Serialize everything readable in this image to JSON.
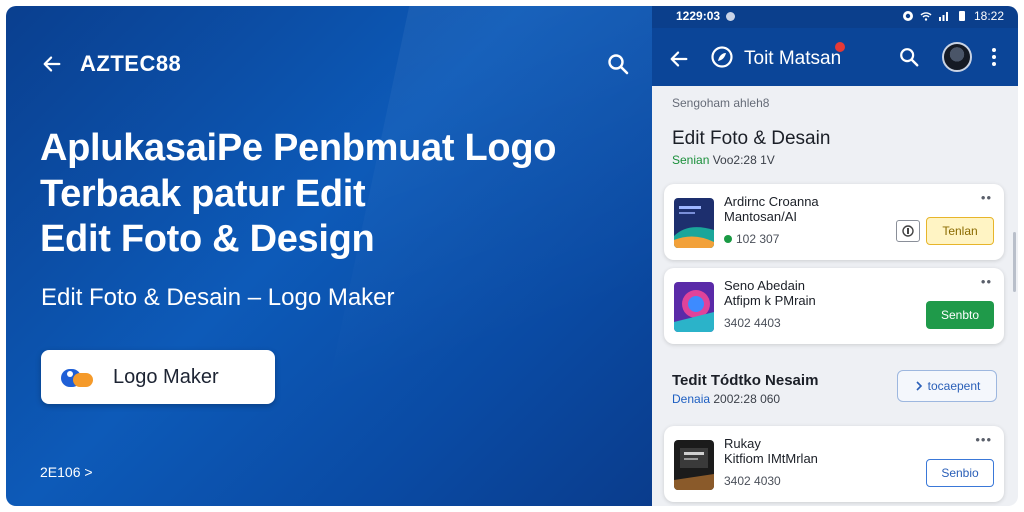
{
  "hero": {
    "brand": "AZTEC88",
    "title_lines": [
      "AplukasaiPe Penbmuat Logo",
      "Terbaak patur Edit",
      "Edit Foto & Design"
    ],
    "subtitle": "Edit Foto & Desain – Logo Maker",
    "cta_label": "Logo Maker",
    "footer": "2E106 >",
    "icons": {
      "back": "arrow-left-icon",
      "search": "search-icon",
      "cta": "logo-maker-app-icon"
    }
  },
  "phone": {
    "status": {
      "time_left": "1229:03",
      "time_right": "18:22",
      "icons": [
        "notification-dot-icon",
        "data-saver-icon",
        "wifi-icon",
        "signal-icon",
        "battery-icon"
      ]
    },
    "appbar": {
      "title": "Toit Matsan",
      "icons": [
        "arrow-left-icon",
        "app-logo-icon",
        "search-icon",
        "avatar",
        "more-vert-icon"
      ]
    },
    "breadcrumb": "Sengoham ahleh8",
    "section1": {
      "title": "Edit Foto & Desain",
      "meta_green": "Senian",
      "meta_rest": " Voo2:28 1V"
    },
    "apps": [
      {
        "name_line1": "Ardirnc Croanna",
        "name_line2": "Mantosan/AI",
        "meta": "102 307",
        "show_rating_dot": true,
        "action": "Tenlan",
        "action_style": "yellow",
        "has_secondary_icon": true,
        "more": "••"
      },
      {
        "name_line1": "Seno Abedain",
        "name_line2": "Atfipm k PMrain",
        "meta": "3402 4403",
        "show_rating_dot": false,
        "action": "Senbto",
        "action_style": "green",
        "has_secondary_icon": false,
        "more": "••"
      },
      {
        "name_line1": "Rukay",
        "name_line2": "Kitfiom IMtMrlan",
        "meta": "3402 4030",
        "show_rating_dot": false,
        "action": "Senbio",
        "action_style": "outline",
        "has_secondary_icon": false,
        "more": "•••"
      }
    ],
    "section2": {
      "title": "Tedit Tódtko Nesaim",
      "meta_blue": "Denaia",
      "meta_rest": " 2002:28 060",
      "button_label": "tocaepent",
      "button_icon": "arrow-right-icon"
    }
  },
  "colors": {
    "hero_blue": "#0d5ab8",
    "appbar_blue": "#0b4598",
    "install_green": "#1f9a4a",
    "install_yellow_border": "#e7b52a",
    "link_blue": "#2a5fb8"
  }
}
